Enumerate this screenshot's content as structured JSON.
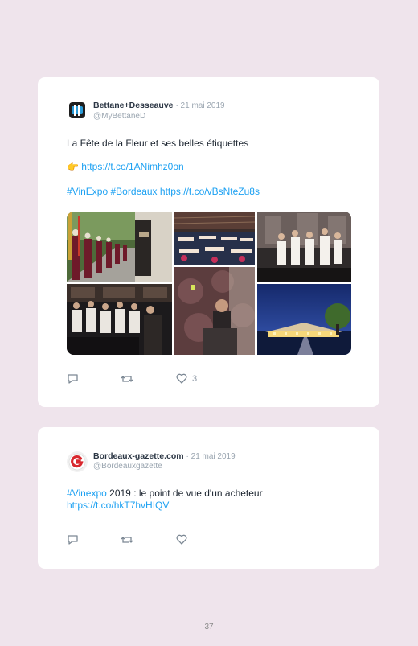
{
  "tweets": [
    {
      "author": "Bettane+Desseauve",
      "date": "· 21 mai 2019",
      "handle": "@MyBettaneD",
      "text_line1": "La Fête de la Fleur et ses belles étiquettes",
      "emoji": "👉",
      "link1": "https://t.co/1ANimhz0on",
      "hashtag1": "#VinExpo",
      "hashtag2": "#Bordeaux",
      "link2": "https://t.co/vBsNteZu8s",
      "photo_count": 6,
      "likes": "3"
    },
    {
      "author": "Bordeaux-gazette.com",
      "date": "· 21 mai 2019",
      "handle": "@Bordeauxgazette",
      "hashtag": "#Vinexpo",
      "text_rest": " 2019 : le point de vue d'un acheteur",
      "link": "https://t.co/hkT7hvHIQV"
    }
  ],
  "icons": {
    "reply": "reply-icon",
    "retweet": "retweet-icon",
    "like": "heart-icon"
  },
  "colors": {
    "background": "#efe4ec",
    "card": "#ffffff",
    "link": "#1da1f2"
  },
  "page_number": "37"
}
